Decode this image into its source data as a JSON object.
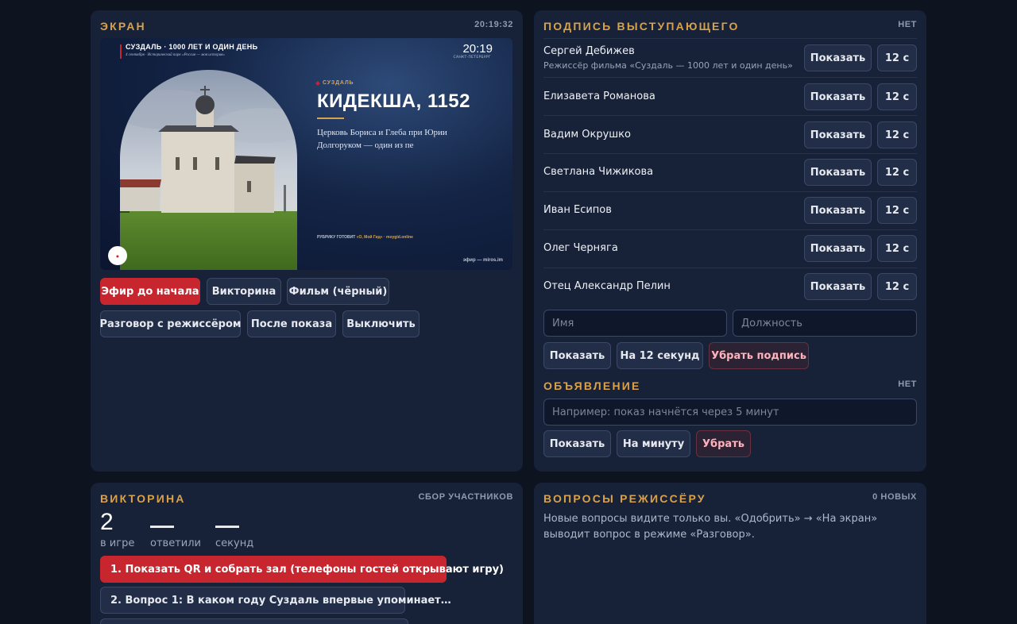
{
  "screen": {
    "title": "ЭКРАН",
    "clock": "20:19:32",
    "preview": {
      "header_title": "СУЗДАЛЬ · 1000 ЛЕТ И ОДИН ДЕНЬ",
      "header_subtitle": "4 сентября · Исторический парк «Россия — моя история»",
      "clock": "20:19",
      "city": "САНКТ-ПЕТЕРБУРГ",
      "tag": "СУЗДАЛЬ",
      "heading": "КИДЕКША, 1152",
      "description": "Церковь Бориса и Глеба при Юрии Долгоруком — один из пе",
      "credit_label": "РУБРИКУ ГОТОВИТ",
      "credit_source": "«О, Мой Гид» · moygid.online",
      "footer": "эфир — miros.im"
    },
    "buttons": [
      {
        "label": "Эфир до начала",
        "active": true
      },
      {
        "label": "Викторина",
        "active": false
      },
      {
        "label": "Фильм (чёрный)",
        "active": false
      },
      {
        "label": "Разговор с режиссёром",
        "active": false
      },
      {
        "label": "После показа",
        "active": false
      },
      {
        "label": "Выключить",
        "active": false
      }
    ]
  },
  "caption": {
    "title": "ПОДПИСЬ ВЫСТУПАЮЩЕГО",
    "status": "НЕТ",
    "show_label": "Показать",
    "duration_label": "12 с",
    "speakers": [
      {
        "name": "Сергей Дебижев",
        "role": "Режиссёр фильма «Суздаль — 1000 лет и один день»"
      },
      {
        "name": "Елизавета Романова",
        "role": ""
      },
      {
        "name": "Вадим Окрушко",
        "role": ""
      },
      {
        "name": "Светлана Чижикова",
        "role": ""
      },
      {
        "name": "Иван Есипов",
        "role": ""
      },
      {
        "name": "Олег Черняга",
        "role": ""
      },
      {
        "name": "Отец Александр Пелин",
        "role": ""
      }
    ],
    "name_placeholder": "Имя",
    "position_placeholder": "Должность",
    "actions": {
      "show": "Показать",
      "for12": "На 12 секунд",
      "remove": "Убрать подпись"
    }
  },
  "announcement": {
    "title": "ОБЪЯВЛЕНИЕ",
    "status": "НЕТ",
    "placeholder": "Например: показ начнётся через 5 минут",
    "actions": {
      "show": "Показать",
      "minute": "На минуту",
      "remove": "Убрать"
    }
  },
  "quiz": {
    "title": "ВИКТОРИНА",
    "status": "СБОР УЧАСТНИКОВ",
    "in_game": "2",
    "in_game_label": "в игре",
    "answered": "—",
    "answered_label": "ответили",
    "seconds": "—",
    "seconds_label": "секунд",
    "steps": [
      {
        "label": "1. Показать QR и собрать зал (телефоны гостей открывают игру)",
        "active": true
      },
      {
        "label": "2. Вопрос 1: В каком году Суздаль впервые упоминает…",
        "active": false
      }
    ]
  },
  "questions": {
    "title": "ВОПРОСЫ РЕЖИССЁРУ",
    "status": "0 НОВЫХ",
    "description": "Новые вопросы видите только вы. «Одобрить» → «На экран» выводит вопрос в режиме «Разговор»."
  },
  "colors": {
    "accent": "#d9a24a",
    "active": "#c8262f",
    "panel": "#172238",
    "background": "#0d1420"
  }
}
